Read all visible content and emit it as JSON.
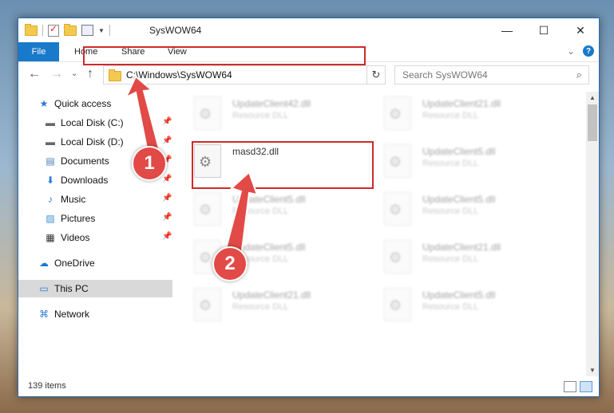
{
  "window": {
    "title": "SysWOW64"
  },
  "titlebar": {
    "minimize": "—",
    "maximize": "☐",
    "close": "✕"
  },
  "ribbon": {
    "file": "File",
    "home": "Home",
    "share": "Share",
    "view": "View",
    "help": "?",
    "expand": "⌄"
  },
  "nav": {
    "back": "←",
    "forward": "→",
    "recent": "⌄",
    "up": "↑",
    "refresh": "↻"
  },
  "address": {
    "path": "C:\\Windows\\SysWOW64",
    "dropdown": "⌄"
  },
  "search": {
    "placeholder": "Search SysWOW64",
    "icon": "⌕"
  },
  "sidebar": {
    "items": [
      {
        "label": "Quick access",
        "icon": "★"
      },
      {
        "label": "Local Disk (C:)",
        "icon": "▬"
      },
      {
        "label": "Local Disk (D:)",
        "icon": "▬"
      },
      {
        "label": "Documents",
        "icon": "▤"
      },
      {
        "label": "Downloads",
        "icon": "⬇"
      },
      {
        "label": "Music",
        "icon": "♪"
      },
      {
        "label": "Pictures",
        "icon": "▨"
      },
      {
        "label": "Videos",
        "icon": "▦"
      },
      {
        "label": "OneDrive",
        "icon": "☁"
      },
      {
        "label": "This PC",
        "icon": "▭"
      },
      {
        "label": "Network",
        "icon": "⌘"
      }
    ],
    "pin": "📌"
  },
  "files": [
    {
      "name": "UpdateClient42.dll",
      "type": "Resource DLL"
    },
    {
      "name": "UpdateClient21.dll",
      "type": "Resource DLL"
    },
    {
      "name": "masd32.dll",
      "type": ""
    },
    {
      "name": "UpdateClient5.dll",
      "type": "Resource DLL"
    },
    {
      "name": "UpdateClient5.dll",
      "type": "Resource DLL"
    },
    {
      "name": "UpdateClient5.dll",
      "type": "Resource DLL"
    },
    {
      "name": "UpdateClient5.dll",
      "type": "Resource DLL"
    },
    {
      "name": "UpdateClient21.dll",
      "type": "Resource DLL"
    },
    {
      "name": "UpdateClient21.dll",
      "type": "Resource DLL"
    },
    {
      "name": "UpdateClient5.dll",
      "type": "Resource DLL"
    }
  ],
  "status": {
    "count": "139 items"
  },
  "callouts": {
    "one": "1",
    "two": "2"
  },
  "colors": {
    "accent": "#1979ca",
    "highlight": "#d02a2a",
    "badge": "#e14a46"
  }
}
